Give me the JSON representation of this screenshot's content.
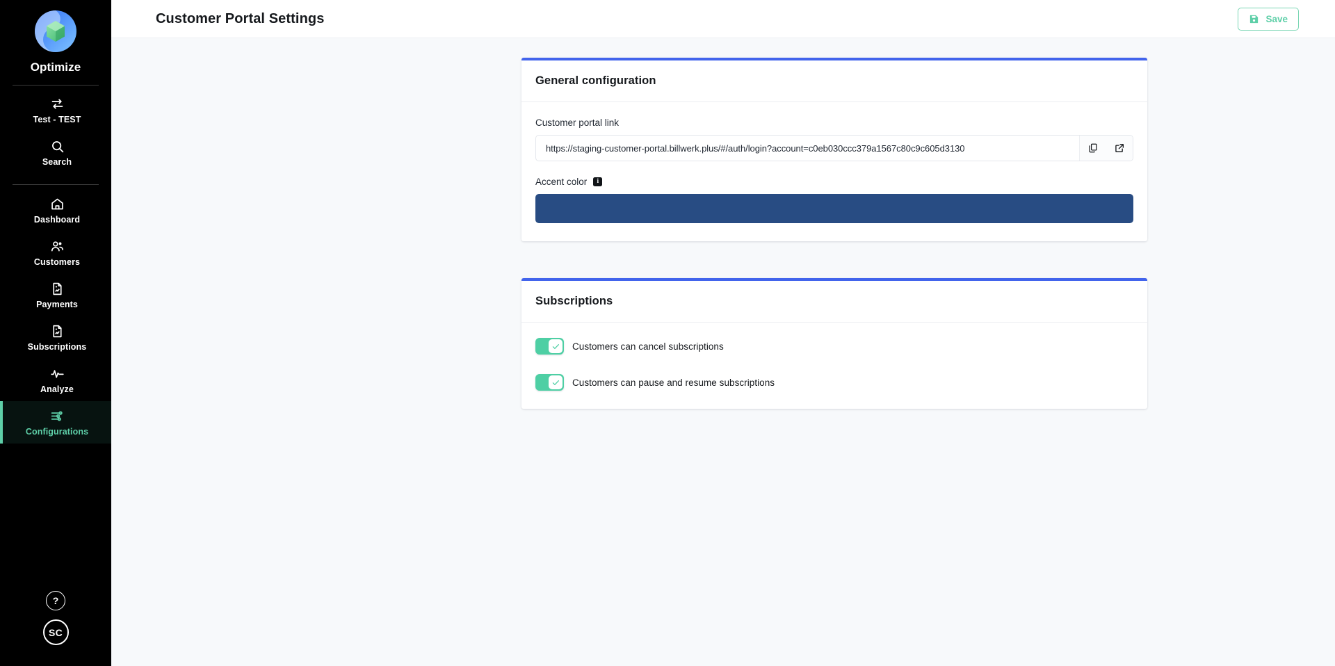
{
  "sidebar": {
    "brand": {
      "name": "Optimize",
      "logo_icon": "optimize-logo"
    },
    "top_items": [
      {
        "label": "Test - TEST",
        "icon": "exchange-arrows-icon",
        "active": false
      },
      {
        "label": "Search",
        "icon": "search-icon",
        "active": false
      }
    ],
    "main_items": [
      {
        "label": "Dashboard",
        "icon": "home-icon",
        "active": false
      },
      {
        "label": "Customers",
        "icon": "users-icon",
        "active": false
      },
      {
        "label": "Payments",
        "icon": "document-chart-icon",
        "active": false
      },
      {
        "label": "Subscriptions",
        "icon": "document-chart-icon",
        "active": false
      },
      {
        "label": "Analyze",
        "icon": "pulse-icon",
        "active": false
      },
      {
        "label": "Configurations",
        "icon": "sliders-icon",
        "active": true
      }
    ],
    "help": {
      "label": "?",
      "icon": "help-icon"
    },
    "avatar": {
      "initials": "SC"
    },
    "active_color": "#5ecfa8"
  },
  "header": {
    "title": "Customer Portal Settings",
    "save": {
      "label": "Save",
      "icon": "save-disk-icon",
      "color": "#5ecfa8"
    }
  },
  "cards": {
    "general": {
      "title": "General configuration",
      "accent_bar_color": "#4264ec",
      "portal_link": {
        "label": "Customer portal link",
        "value": "https://staging-customer-portal.billwerk.plus/#/auth/login?account=c0eb030ccc379a1567c80c9c605d3130",
        "placeholder": "Customer portal link",
        "copy_icon": "copy-icon",
        "open_icon": "external-link-icon"
      },
      "accent_color": {
        "label": "Accent color",
        "info_icon": "info-icon",
        "info_badge": "i",
        "value": "#284c83"
      }
    },
    "subscriptions": {
      "title": "Subscriptions",
      "accent_bar_color": "#4264ec",
      "toggles": [
        {
          "label": "Customers can cancel subscriptions",
          "checked": true
        },
        {
          "label": "Customers can pause and resume subscriptions",
          "checked": true
        }
      ],
      "toggle_on_color": "#4ecfa4"
    }
  }
}
